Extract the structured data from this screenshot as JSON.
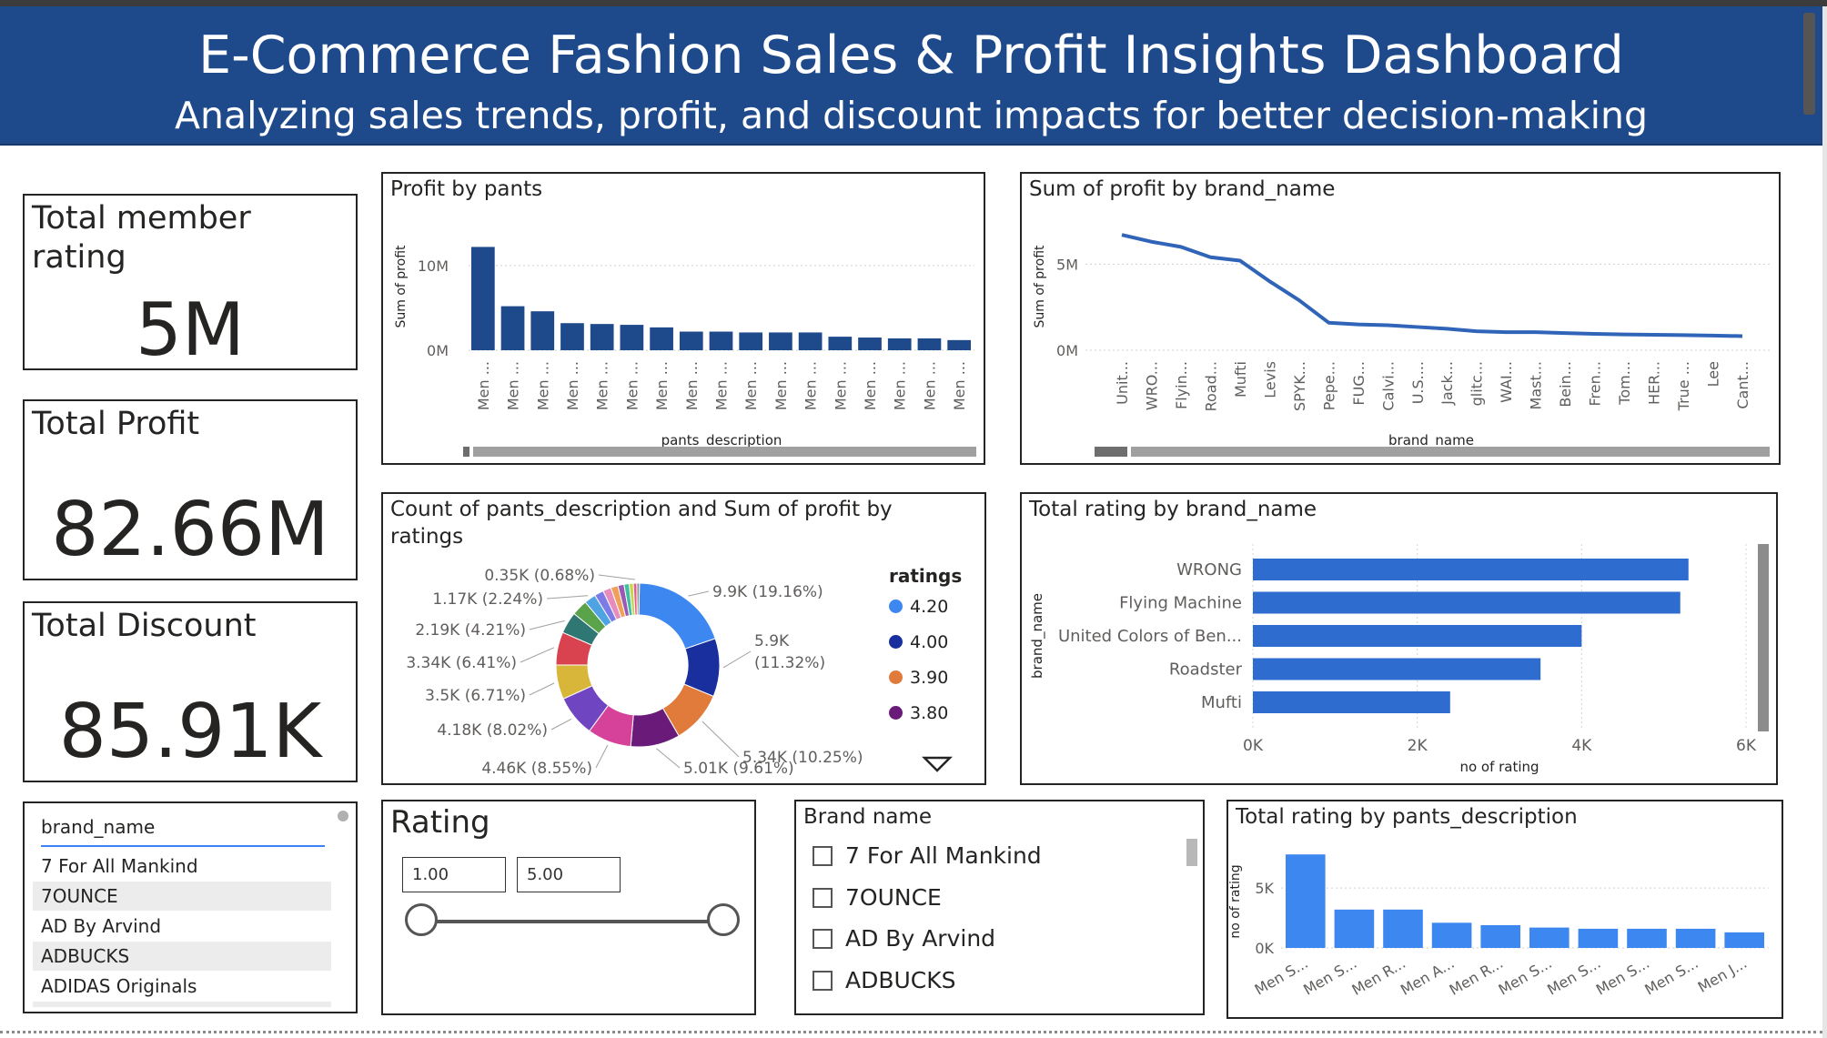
{
  "header": {
    "title": "E-Commerce Fashion Sales & Profit Insights Dashboard",
    "subtitle": "Analyzing sales trends, profit, and discount impacts for better decision-making"
  },
  "cards": {
    "member_rating": {
      "label": "Total member rating",
      "value": "5M"
    },
    "profit": {
      "label": "Total Profit",
      "value": "82.66M"
    },
    "discount": {
      "label": "Total Discount",
      "value": "85.91K"
    }
  },
  "brand_list": {
    "header": "brand_name",
    "items": [
      "7 For All Mankind",
      "7OUNCE",
      "AD By Arvind",
      "ADBUCKS",
      "ADIDAS Originals"
    ]
  },
  "rating_slicer": {
    "title": "Rating",
    "min": "1.00",
    "max": "5.00"
  },
  "brand_checklist": {
    "title": "Brand name",
    "items": [
      "7 For All Mankind",
      "7OUNCE",
      "AD By Arvind",
      "ADBUCKS"
    ]
  },
  "colors": {
    "header_bg": "#1e4a8c",
    "bar_dark": "#1e4a8c",
    "line_blue": "#2f64b8",
    "bar_blue": "#2f6cd0",
    "bar_bright": "#3d87f0"
  },
  "chart_data": [
    {
      "id": "profit_by_pants",
      "type": "bar",
      "title": "Profit by pants",
      "xlabel": "pants_description",
      "ylabel": "Sum of profit",
      "yticks": [
        "0M",
        "10M"
      ],
      "ylim": [
        0,
        13
      ],
      "categories": [
        "Men ...",
        "Men ...",
        "Men ...",
        "Men ...",
        "Men ...",
        "Men ...",
        "Men ...",
        "Men ...",
        "Men ...",
        "Men ...",
        "Men ...",
        "Men ...",
        "Men ...",
        "Men ...",
        "Men ...",
        "Men ...",
        "Men ..."
      ],
      "values": [
        12.2,
        5.2,
        4.6,
        3.2,
        3.1,
        3.0,
        2.7,
        2.2,
        2.2,
        2.1,
        2.1,
        2.1,
        1.6,
        1.5,
        1.4,
        1.4,
        1.2
      ],
      "unit": "M",
      "grid": true
    },
    {
      "id": "profit_by_brand",
      "type": "line",
      "title": "Sum of profit by brand_name",
      "xlabel": "brand_name",
      "ylabel": "Sum of profit",
      "yticks": [
        "0M",
        "5M"
      ],
      "ylim": [
        0,
        7.5
      ],
      "categories": [
        "Unit...",
        "WRO...",
        "Flyin...",
        "Road...",
        "Mufti",
        "Levis",
        "SPYK...",
        "Pepe...",
        "FUG...",
        "Calvi...",
        "U.S....",
        "Jack...",
        "glitc...",
        "WAI...",
        "Mast...",
        "Bein...",
        "Fren...",
        "Tom...",
        "HER...",
        "True ...",
        "Lee",
        "Cant..."
      ],
      "values": [
        6.7,
        6.3,
        6.0,
        5.4,
        5.2,
        4.0,
        2.9,
        1.6,
        1.5,
        1.45,
        1.35,
        1.25,
        1.1,
        1.05,
        1.05,
        1.0,
        0.95,
        0.92,
        0.9,
        0.88,
        0.85,
        0.82
      ],
      "unit": "M",
      "grid": true
    },
    {
      "id": "donut_ratings",
      "type": "pie",
      "title": "Count of pants_description and Sum of profit by ratings",
      "legend_title": "ratings",
      "legend": [
        {
          "label": "4.20",
          "color": "#3d87f0"
        },
        {
          "label": "4.00",
          "color": "#1a2f9e"
        },
        {
          "label": "3.90",
          "color": "#e07b3c"
        },
        {
          "label": "3.80",
          "color": "#6a1b7a"
        }
      ],
      "slices": [
        {
          "value": 19.16,
          "label": "9.9K (19.16%)",
          "color": "#3d87f0"
        },
        {
          "value": 11.32,
          "label": "5.9K (11.32%)",
          "color": "#1a2f9e"
        },
        {
          "value": 10.25,
          "label": "5.34K (10.25%)",
          "color": "#e07b3c"
        },
        {
          "value": 9.61,
          "label": "5.01K (9.61%)",
          "color": "#6a1b7a"
        },
        {
          "value": 8.55,
          "label": "4.46K (8.55%)",
          "color": "#d6419a"
        },
        {
          "value": 8.02,
          "label": "4.18K (8.02%)",
          "color": "#6f45c2"
        },
        {
          "value": 6.71,
          "label": "3.5K (6.71%)",
          "color": "#d7b63a"
        },
        {
          "value": 6.41,
          "label": "3.34K (6.41%)",
          "color": "#d9434f"
        },
        {
          "value": 4.21,
          "label": "2.19K (4.21%)",
          "color": "#2f7772"
        },
        {
          "value": 3.1,
          "label": "",
          "color": "#5aa34a"
        },
        {
          "value": 2.24,
          "label": "1.17K (2.24%)",
          "color": "#4fa3e3"
        },
        {
          "value": 1.8,
          "label": "",
          "color": "#7d7ce6"
        },
        {
          "value": 1.6,
          "label": "",
          "color": "#e88bbd"
        },
        {
          "value": 1.4,
          "label": "",
          "color": "#f0a05a"
        },
        {
          "value": 1.2,
          "label": "",
          "color": "#9b59b6"
        },
        {
          "value": 1.0,
          "label": "",
          "color": "#3dbfa0"
        },
        {
          "value": 0.8,
          "label": "",
          "color": "#c4d64a"
        },
        {
          "value": 0.68,
          "label": "0.35K (0.68%)",
          "color": "#e55c8a"
        },
        {
          "value": 0.5,
          "label": "",
          "color": "#8c8c8c"
        }
      ]
    },
    {
      "id": "rating_by_brand",
      "type": "bar",
      "orientation": "horizontal",
      "title": "Total rating by brand_name",
      "xlabel": "no of rating",
      "ylabel": "brand_name",
      "xticks": [
        "0K",
        "2K",
        "4K",
        "6K"
      ],
      "xlim": [
        0,
        6
      ],
      "categories": [
        "WRONG",
        "Flying Machine",
        "United Colors of Ben...",
        "Roadster",
        "Mufti"
      ],
      "values": [
        5.3,
        5.2,
        4.0,
        3.5,
        2.4
      ],
      "unit": "K",
      "grid": true
    },
    {
      "id": "rating_by_pants",
      "type": "bar",
      "title": "Total rating by pants_description",
      "ylabel": "no of rating",
      "yticks": [
        "0K",
        "5K"
      ],
      "ylim": [
        0,
        8.5
      ],
      "categories": [
        "Men S...",
        "Men S...",
        "Men R...",
        "Men A...",
        "Men R...",
        "Men S...",
        "Men S...",
        "Men S...",
        "Men S...",
        "Men J..."
      ],
      "values": [
        7.8,
        3.2,
        3.2,
        2.1,
        1.9,
        1.7,
        1.6,
        1.6,
        1.6,
        1.3
      ],
      "unit": "K",
      "grid": true
    }
  ]
}
